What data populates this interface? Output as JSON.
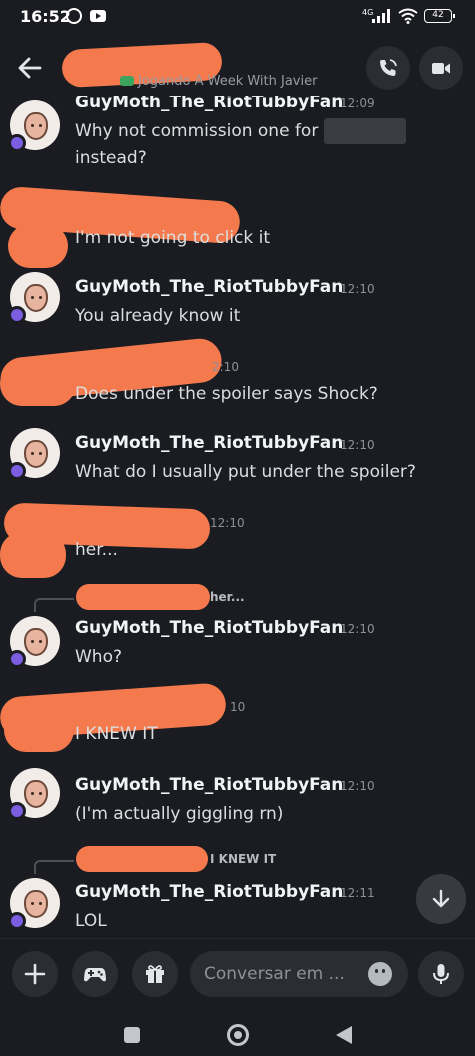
{
  "status_bar": {
    "time": "16:52",
    "network": "4G",
    "battery": "42"
  },
  "header": {
    "activity_status": "Jogando A Week With Javier"
  },
  "messages": [
    {
      "author": "GuyMoth_The_RiotTubbyFan",
      "time": "12:09",
      "line1": "Why not commission one for",
      "line2": "instead?"
    },
    {
      "author": "",
      "time": "",
      "line1": "I'm not going to click it"
    },
    {
      "author": "GuyMoth_The_RiotTubbyFan",
      "time": "12:10",
      "line1": "You already know it"
    },
    {
      "author": "",
      "time": "2:10",
      "line1": "Does under the spoiler says Shock?"
    },
    {
      "author": "GuyMoth_The_RiotTubbyFan",
      "time": "12:10",
      "line1": "What do I usually put under the spoiler?"
    },
    {
      "author": "",
      "time": "12:10",
      "line1": "her..."
    },
    {
      "reply_snippet": "her...",
      "author": "GuyMoth_The_RiotTubbyFan",
      "time": "12:10",
      "line1": "Who?"
    },
    {
      "author": "",
      "time": "10",
      "line1": "I KNEW IT"
    },
    {
      "author": "GuyMoth_The_RiotTubbyFan",
      "time": "12:10",
      "line1": "(I'm actually giggling rn)"
    },
    {
      "reply_snippet": "I KNEW IT",
      "author": "GuyMoth_The_RiotTubbyFan",
      "time": "12:11",
      "line1": "LOL"
    }
  ],
  "composer": {
    "placeholder": "Conversar em ..."
  },
  "colors": {
    "background": "#1b1c21",
    "redaction": "#f47a4e",
    "accent_purple": "#7a5de0"
  },
  "icons": [
    "back-arrow-icon",
    "phone-call-icon",
    "video-camera-icon",
    "plus-icon",
    "gamepad-icon",
    "gift-icon",
    "emoji-icon",
    "microphone-icon",
    "chevron-down-icon"
  ]
}
